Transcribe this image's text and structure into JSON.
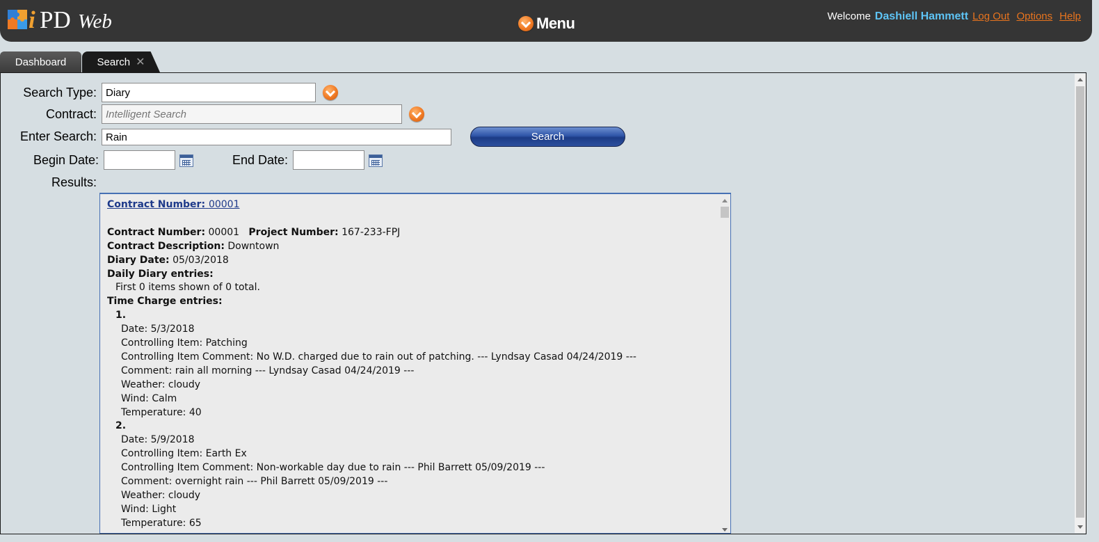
{
  "header": {
    "logo_text": {
      "i": "i",
      "pd": "PD",
      "web": "Web"
    },
    "menu_label": "Menu",
    "welcome": "Welcome",
    "username": "Dashiell Hammett",
    "links": {
      "logout": "Log Out",
      "options": "Options",
      "help": "Help"
    }
  },
  "tabs": [
    {
      "label": "Dashboard",
      "active": false
    },
    {
      "label": "Search",
      "active": true,
      "close_glyph": "✕"
    }
  ],
  "form": {
    "search_type": {
      "label": "Search Type:",
      "value": "Diary"
    },
    "contract": {
      "label": "Contract:",
      "placeholder": "Intelligent Search",
      "value": ""
    },
    "enter_search": {
      "label": "Enter Search:",
      "value": "Rain"
    },
    "search_button": "Search",
    "begin_date": {
      "label": "Begin Date:",
      "value": ""
    },
    "end_date": {
      "label": "End Date:",
      "value": ""
    },
    "results_label": "Results:"
  },
  "results": {
    "header_link_label": "Contract Number:",
    "header_link_value": "00001",
    "contract_number_label": "Contract Number:",
    "contract_number": "00001",
    "project_number_label": "Project Number:",
    "project_number": "167-233-FPJ",
    "description_label": "Contract Description:",
    "description": "Downtown",
    "diary_date_label": "Diary Date:",
    "diary_date": "05/03/2018",
    "daily_diary_label": "Daily Diary entries:",
    "daily_diary_summary": "First 0 items shown of 0 total.",
    "time_charge_label": "Time Charge entries:",
    "entries": [
      {
        "index": "1.",
        "date": "Date: 5/3/2018",
        "controlling_item": "Controlling Item: Patching",
        "controlling_item_comment": "Controlling Item Comment: No W.D. charged due to rain out of patching. --- Lyndsay Casad 04/24/2019 ---",
        "comment": "Comment: rain all morning --- Lyndsay Casad 04/24/2019 ---",
        "weather": "Weather: cloudy",
        "wind": "Wind: Calm",
        "temperature": "Temperature: 40"
      },
      {
        "index": "2.",
        "date": "Date: 5/9/2018",
        "controlling_item": "Controlling Item: Earth Ex",
        "controlling_item_comment": "Controlling Item Comment: Non-workable day due to rain --- Phil Barrett 05/09/2019 ---",
        "comment": "Comment: overnight rain --- Phil Barrett 05/09/2019 ---",
        "weather": "Weather: cloudy",
        "wind": "Wind: Light",
        "temperature": "Temperature: 65"
      }
    ]
  },
  "colors": {
    "topbar": "#353535",
    "accent_orange": "#f07a24",
    "username_blue": "#5ec4f5",
    "search_button": "#2f55a8",
    "page_bg": "#d6dee2"
  }
}
